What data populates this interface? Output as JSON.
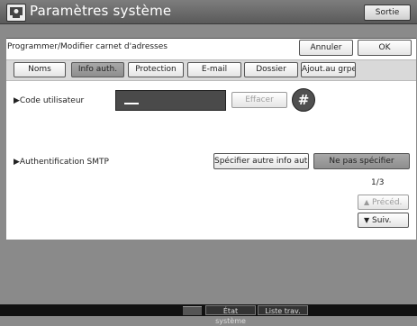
{
  "window": {
    "title": "Paramètres système",
    "exit_label": "Sortie",
    "icon": "system-settings-icon"
  },
  "panel": {
    "title": "Programmer/Modifier carnet d'adresses",
    "cancel_label": "Annuler",
    "ok_label": "OK"
  },
  "tabs": [
    {
      "label": "Noms",
      "active": false
    },
    {
      "label": "Info auth.",
      "active": true
    },
    {
      "label": "Protection",
      "active": false
    },
    {
      "label": "E-mail",
      "active": false
    },
    {
      "label": "Dossier",
      "active": false
    },
    {
      "label": "Ajout.au grpe",
      "active": false
    }
  ],
  "user_code": {
    "label": "▶Code utilisateur",
    "value": "",
    "clear_label": "Effacer",
    "hash_label": "#"
  },
  "smtp": {
    "label": "▶Authentification SMTP",
    "specify_label": "Spécifier autre info auth.",
    "no_specify_label": "Ne pas spécifier",
    "selected": "Ne pas spécifier"
  },
  "pagination": {
    "page": "1/3",
    "prev_label": "Précéd.",
    "next_label": "Suiv.",
    "prev_icon": "triangle-up-icon",
    "next_icon": "triangle-down-icon"
  },
  "bottom_bar": {
    "status_label": "État système",
    "jobs_label": "Liste trav."
  },
  "colors": {
    "titlebar": "#6a6a6a",
    "background": "#8a8a8a",
    "panel": "#ffffff",
    "active_tab": "#9a9a9a"
  }
}
